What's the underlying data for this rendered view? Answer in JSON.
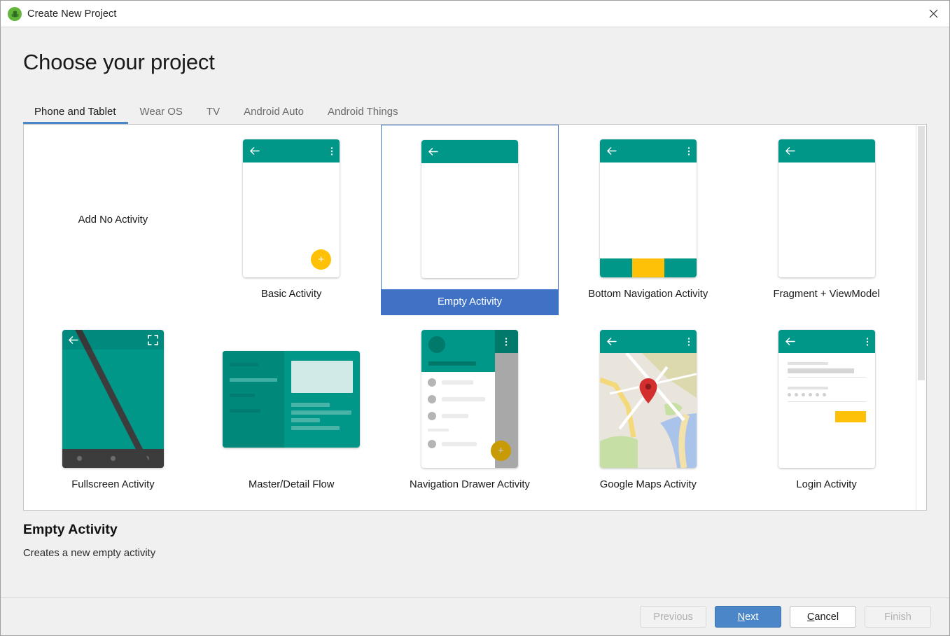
{
  "window": {
    "title": "Create New Project",
    "icon": "android-robot-icon",
    "close_label": "close-icon"
  },
  "heading": "Choose your project",
  "tabs": [
    {
      "label": "Phone and Tablet",
      "active": true
    },
    {
      "label": "Wear OS",
      "active": false
    },
    {
      "label": "TV",
      "active": false
    },
    {
      "label": "Android Auto",
      "active": false
    },
    {
      "label": "Android Things",
      "active": false
    }
  ],
  "templates": [
    {
      "label": "Add No Activity",
      "kind": "text-only",
      "selected": false
    },
    {
      "label": "Basic Activity",
      "kind": "basic",
      "selected": false
    },
    {
      "label": "Empty Activity",
      "kind": "empty",
      "selected": true
    },
    {
      "label": "Bottom Navigation Activity",
      "kind": "bottom-nav",
      "selected": false
    },
    {
      "label": "Fragment + ViewModel",
      "kind": "fragment-viewmodel",
      "selected": false
    },
    {
      "label": "Fullscreen Activity",
      "kind": "fullscreen",
      "selected": false
    },
    {
      "label": "Master/Detail Flow",
      "kind": "master-detail",
      "selected": false
    },
    {
      "label": "Navigation Drawer Activity",
      "kind": "nav-drawer",
      "selected": false
    },
    {
      "label": "Google Maps Activity",
      "kind": "google-maps",
      "selected": false
    },
    {
      "label": "Login Activity",
      "kind": "login",
      "selected": false
    }
  ],
  "description": {
    "title": "Empty Activity",
    "text": "Creates a new empty activity"
  },
  "footer": {
    "previous": {
      "label": "Previous",
      "enabled": false
    },
    "next": {
      "label": "Next",
      "mnemonic": "N",
      "enabled": true,
      "primary": true
    },
    "cancel": {
      "label": "Cancel",
      "mnemonic": "C",
      "enabled": true
    },
    "finish": {
      "label": "Finish",
      "enabled": false
    }
  },
  "colors": {
    "teal": "#009688",
    "teal_dark": "#00796b",
    "amber": "#FFC107",
    "accent_blue": "#4a86c8",
    "selection_blue": "#3f72c4",
    "map_land": "#e9e5dc",
    "map_water": "#aac3ea",
    "map_green": "#c6dfa5",
    "map_road": "#ffffff",
    "map_highway": "#f4d97a",
    "pin_red": "#d32f2f",
    "android_green": "#63b63b"
  },
  "scrollbar": {
    "visible": true,
    "thumb_fraction": 0.66
  }
}
